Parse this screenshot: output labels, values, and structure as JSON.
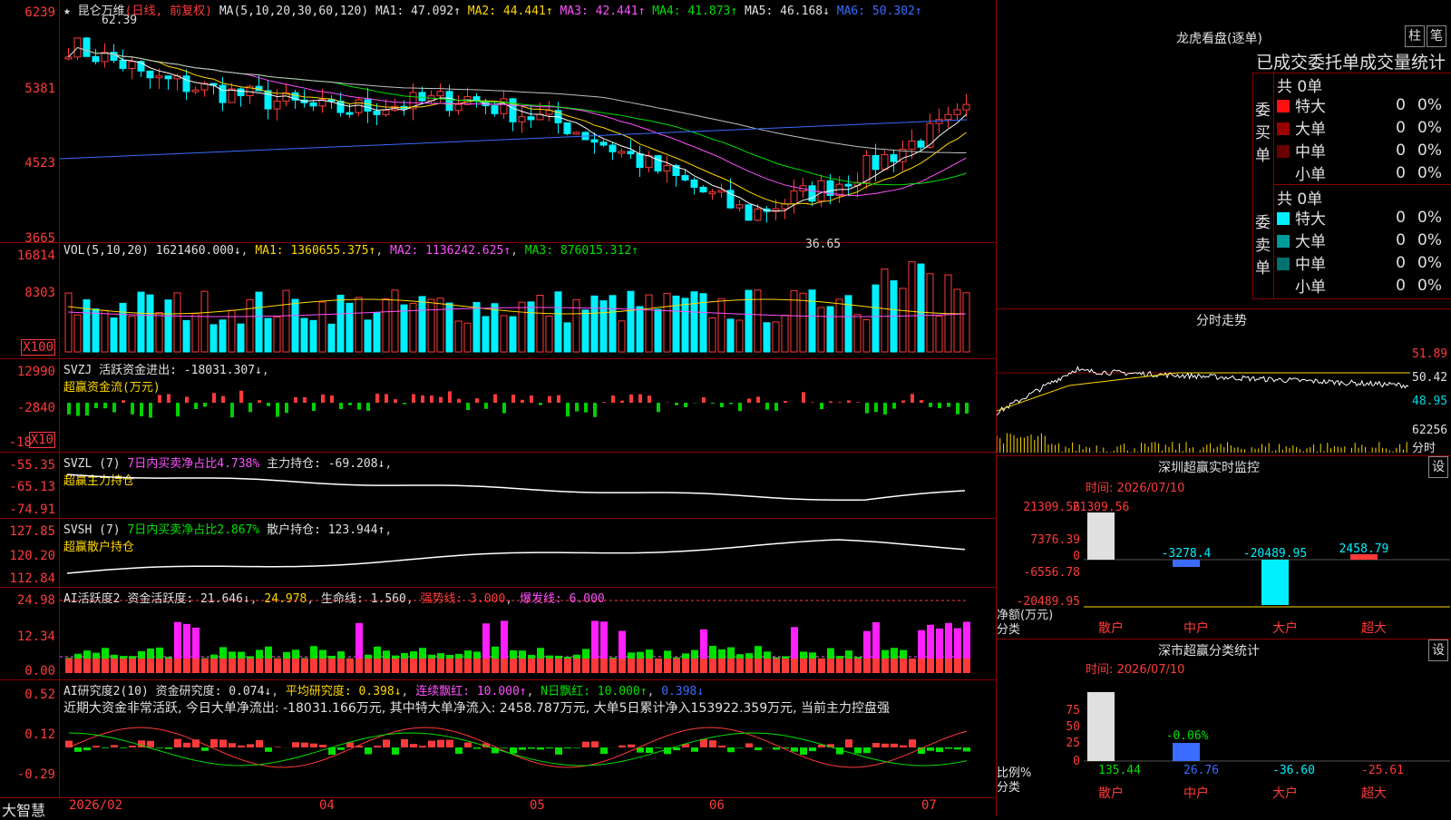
{
  "colors": {
    "up": "#ff3a3a",
    "down": "#00f0ff",
    "border": "#8a0000",
    "ma1": "#ffffff",
    "ma2": "#ffd800",
    "ma3": "#ff50ff",
    "ma4": "#00e000",
    "ma5": "#c0c0c0",
    "ma6": "#3b6bff"
  },
  "price": {
    "title": "昆仑万维",
    "period": "(日线, 前复权)",
    "ma_params": "MA(5,10,20,30,60,120)",
    "ma1": "MA1: 47.092↑",
    "ma2": "MA2: 44.441↑",
    "ma3": "MA3: 42.441↑",
    "ma4": "MA4: 41.873↑",
    "ma5": "MA5: 46.168↓",
    "ma6": "MA6: 50.302↑",
    "ticks": [
      "6239",
      "5381",
      "4523",
      "3665"
    ],
    "high_marker": "62.39",
    "low_marker": "36.65"
  },
  "vol": {
    "label": "VOL(5,10,20)",
    "val": "1621460.000↓",
    "ma1": "MA1: 1360655.375↑",
    "ma2": "MA2: 1136242.625↑",
    "ma3": "MA3: 876015.312↑",
    "ticks": [
      "16814",
      "8303"
    ],
    "unit": "X100"
  },
  "svzj": {
    "label": "SVZJ",
    "active": "活跃资金进出: -18031.307↓",
    "sub": "超赢资金流(万元)",
    "ticks": [
      "12990",
      "-2840",
      "-18"
    ],
    "unit": "X10"
  },
  "svzl": {
    "label": "SVZL (7)",
    "ratio": "7日内买卖净占比4.738%",
    "hold": "主力持仓: -69.208↓",
    "sub": "超赢主力持仓",
    "ticks": [
      "-55.35",
      "-65.13",
      "-74.91"
    ]
  },
  "svsh": {
    "label": "SVSH (7)",
    "ratio": "7日内买卖净占比2.867%",
    "hold": "散户持仓: 123.944↑",
    "sub": "超赢散户持仓",
    "ticks": [
      "127.85",
      "120.20",
      "112.84"
    ]
  },
  "ai": {
    "label": "AI活跃度2",
    "f1": "资金活跃度: 21.646↓",
    "f2": "24.978",
    "f3": "生命线: 1.560",
    "f4": "强势线: 3.000",
    "f5": "爆发线: 6.000",
    "ticks": [
      "24.98",
      "12.34",
      "0.00"
    ]
  },
  "res": {
    "label": "AI研究度2(10)",
    "f1": "资金研究度: 0.074↓",
    "f2": "平均研究度: 0.398↓",
    "f3": "连续飘红: 10.000↑",
    "f4": "N日飘红: 10.000↑",
    "f5": "0.398↓",
    "note": "近期大资金非常活跃, 今日大单净流出: -18031.166万元, 其中特大单净流入: 2458.787万元, 大单5日累计净入153922.359万元, 当前主力控盘强",
    "ticks": [
      "0.52",
      "0.12",
      "-0.29"
    ]
  },
  "xaxis": {
    "brand": "大智慧",
    "labels": [
      "2026/02",
      "04",
      "05",
      "06",
      "07"
    ]
  },
  "lhb": {
    "title": "龙虎看盘(逐单)",
    "btn1": "柱",
    "btn2": "笔",
    "head": "已成交委托单成交量统计",
    "buy_side": "委买单",
    "sell_side": "委卖单",
    "count": "共 0单",
    "rows": [
      [
        "特大",
        "0",
        "0%"
      ],
      [
        "大单",
        "0",
        "0%"
      ],
      [
        "中单",
        "0",
        "0%"
      ],
      [
        "小单",
        "0",
        "0%"
      ]
    ]
  },
  "intraday": {
    "title": "分时走势",
    "ticks": [
      "51.89",
      "50.42",
      "48.95"
    ],
    "vol_tick": "62256",
    "vol_label": "分时"
  },
  "monitor": {
    "title": "深圳超赢实时监控",
    "btn": "设",
    "time": "时间: 2026/07/10",
    "ticks": [
      "21309.56",
      "7376.39",
      "0",
      "-6556.78",
      "-20489.95"
    ],
    "axis": "净额(万元)",
    "cls": "分类",
    "values": [
      "21309.56",
      "-3278.4",
      "-20489.95",
      "2458.79"
    ],
    "cats": [
      "散户",
      "中户",
      "大户",
      "超大"
    ]
  },
  "classify": {
    "title": "深市超赢分类统计",
    "btn": "设",
    "time": "时间: 2026/07/10",
    "ticks": [
      "75",
      "50",
      "25",
      "0"
    ],
    "axis": "比例%",
    "cls": "分类",
    "mid": "-0.06%",
    "values": [
      "135.44",
      "26.76",
      "-36.60",
      "-25.61"
    ],
    "cats": [
      "散户",
      "中户",
      "大户",
      "超大"
    ]
  }
}
